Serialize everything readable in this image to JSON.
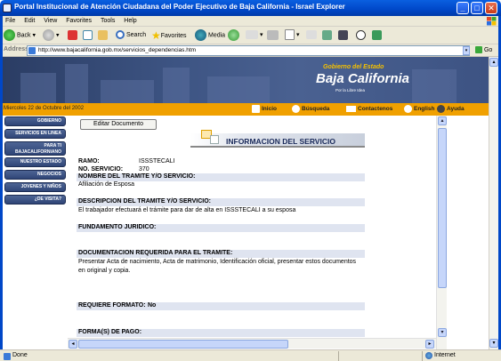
{
  "window": {
    "title": "Portal Institucional de Atención Ciudadana del Poder Ejecutivo de Baja California - Israel Explorer"
  },
  "menu": [
    "File",
    "Edit",
    "View",
    "Favorites",
    "Tools",
    "Help"
  ],
  "toolbar": {
    "back": "Back",
    "search": "Search",
    "favorites": "Favorites",
    "media": "Media"
  },
  "address": {
    "label": "Address",
    "url": "http://www.bajacalifornia.gob.mx/servicios_dependencias.htm",
    "go": "Go"
  },
  "banner": {
    "logo_top": "Gobierno del Estado",
    "logo_main": "Baja California",
    "logo_sub": "Por la Libre Idea"
  },
  "top_nav": {
    "date": "Miercoles 22 de Octubre del 2002",
    "inicio": "Inicio",
    "busqueda": "Búsqueda",
    "contactenos": "Contactenos",
    "english": "English",
    "ayuda": "Ayuda"
  },
  "sidebar": {
    "items": [
      "GOBIERNO",
      "SERVICIOS EN LINEA",
      "PARA TI BAJACALIFORNIANO",
      "NUESTRO ESTADO",
      "NEGOCIOS",
      "JOVENES Y NIÑOS",
      "¿DE VISITA?"
    ]
  },
  "content": {
    "edit_button": "Editar Documento",
    "header": "INFORMACION DEL SERVICIO",
    "ramo_label": "RAMO:",
    "ramo_value": "ISSSTECALI",
    "no_servicio_label": "NO. SERVICIO:",
    "no_servicio_value": "370",
    "nombre_label": "NOMBRE DEL TRAMITE Y/O SERVICIO:",
    "nombre_value": "Afiliación de Esposa",
    "descripcion_label": "DESCRIPCION DEL TRAMITE Y/O SERVICIO:",
    "descripcion_value": "El trabajador efectuará el trámite para dar de alta en ISSSTECALI a su esposa",
    "fundamento_label": "FUNDAMENTO JURIDICO:",
    "documentacion_label": "DOCUMENTACION REQUERIDA PARA EL TRAMITE:",
    "documentacion_value_1": "Presentar Acta de nacimiento, Acta de matrimonio, Identificación oficial, presentar estos documentos",
    "documentacion_value_2": "en original y copia.",
    "requiere_formato_label": "REQUIERE FORMATO:",
    "requiere_formato_value": "No",
    "forma_pago_label": "FORMA(S) DE PAGO:"
  },
  "status": {
    "text": "Done",
    "zone": "Internet"
  }
}
